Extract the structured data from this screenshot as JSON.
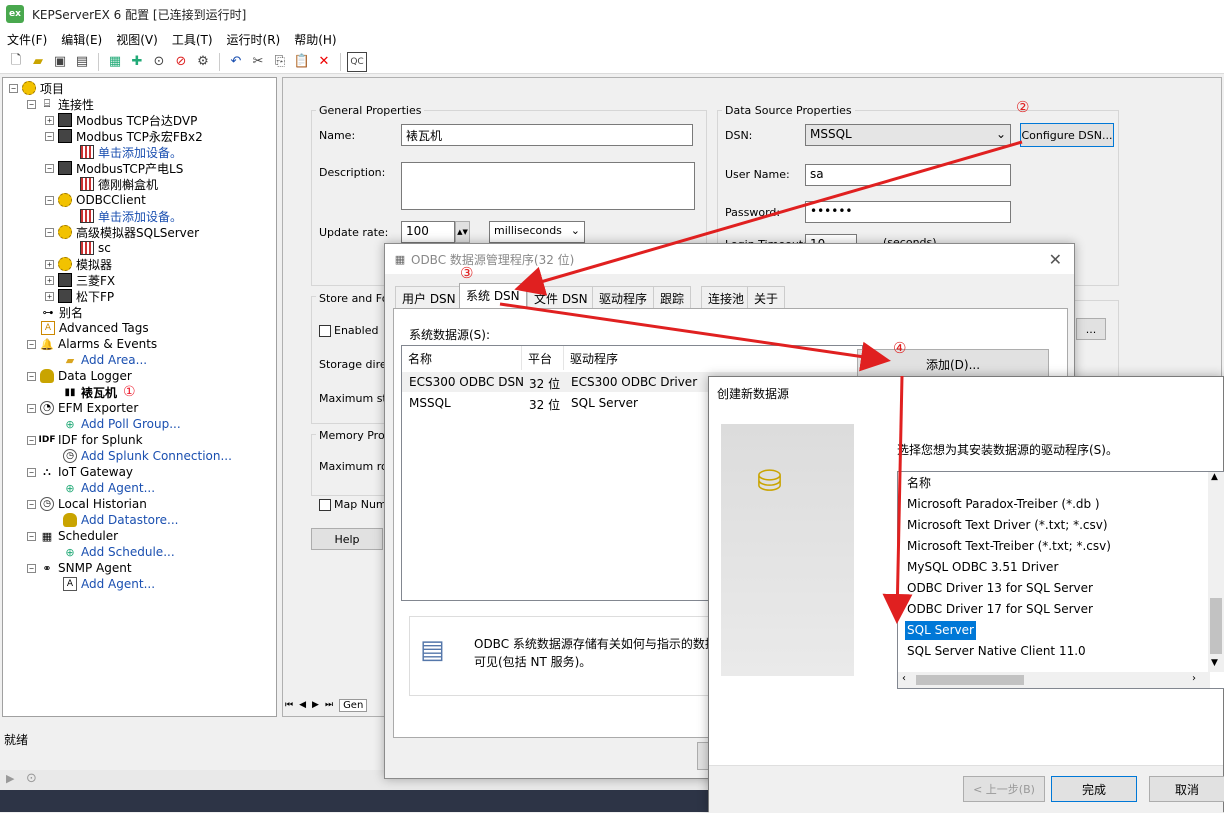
{
  "app": {
    "title": "KEPServerEX 6 配置 [已连接到运行时]",
    "icon_text": "ex"
  },
  "menu": [
    "文件(F)",
    "编辑(E)",
    "视图(V)",
    "工具(T)",
    "运行时(R)",
    "帮助(H)"
  ],
  "toolbar": [
    "new-icon",
    "open-icon",
    "save-icon",
    "save-as-icon",
    "device-icon",
    "add-icon",
    "play-icon",
    "stop-icon",
    "properties-icon",
    "undo-icon",
    "cut-icon",
    "copy-icon",
    "paste-icon",
    "delete-icon",
    "quick-client-icon"
  ],
  "tree": {
    "project": "项目",
    "connectivity": "连接性",
    "items": [
      {
        "label": "Modbus TCP台达DVP",
        "level": 2,
        "icon": "device"
      },
      {
        "label": "Modbus TCP永宏FBx2",
        "level": 2,
        "icon": "device"
      },
      {
        "label": "单击添加设备。",
        "level": 3,
        "icon": "grid",
        "link": true
      },
      {
        "label": "ModbusTCP产电LS",
        "level": 2,
        "icon": "device"
      },
      {
        "label": "德刚槲盒机",
        "level": 3,
        "icon": "grid"
      },
      {
        "label": "ODBCClient",
        "level": 2,
        "icon": "gear"
      },
      {
        "label": "单击添加设备。",
        "level": 3,
        "icon": "grid",
        "link": true
      },
      {
        "label": "高级模拟器SQLServer",
        "level": 2,
        "icon": "gear"
      },
      {
        "label": "sc",
        "level": 3,
        "icon": "grid"
      },
      {
        "label": "模拟器",
        "level": 2,
        "icon": "gear"
      },
      {
        "label": "三菱FX",
        "level": 2,
        "icon": "device"
      },
      {
        "label": "松下FP",
        "level": 2,
        "icon": "device"
      }
    ],
    "alias": "别名",
    "plugins": [
      {
        "label": "Advanced Tags"
      },
      {
        "label": "Alarms & Events",
        "child": "Add Area..."
      },
      {
        "label": "Data Logger",
        "child": "裱瓦机",
        "child_bold": true,
        "annot": "①"
      },
      {
        "label": "EFM Exporter",
        "child": "Add Poll Group..."
      },
      {
        "label": "IDF for Splunk",
        "child": "Add Splunk Connection..."
      },
      {
        "label": "IoT Gateway",
        "child": "Add Agent..."
      },
      {
        "label": "Local Historian",
        "child": "Add Datastore..."
      },
      {
        "label": "Scheduler",
        "child": "Add Schedule..."
      },
      {
        "label": "SNMP Agent",
        "child": "Add Agent..."
      }
    ]
  },
  "props": {
    "general_title": "General Properties",
    "name_label": "Name:",
    "name_value": "裱瓦机",
    "desc_label": "Description:",
    "update_label": "Update rate:",
    "update_value": "100",
    "update_unit": "milliseconds",
    "ds_title": "Data Source Properties",
    "dsn_label": "DSN:",
    "dsn_value": "MSSQL",
    "configure_btn": "Configure DSN...",
    "user_label": "User Name:",
    "user_value": "sa",
    "pwd_label": "Password:",
    "pwd_value": "••••••",
    "login_label": "Login Timeout:",
    "login_value": "10",
    "login_unit": "(seconds)",
    "store_title": "Store and For",
    "enabled_label": "Enabled",
    "storage_label": "Storage direct",
    "max_storage_label": "Maximum stor",
    "memory_title": "Memory Prope",
    "max_rows_label": "Maximum row",
    "map_label": "Map Nume",
    "help_btn": "Help",
    "browse_btn": "...",
    "gen_tab": "Gen"
  },
  "status": {
    "text": "就绪"
  },
  "odbc": {
    "title": "ODBC 数据源管理程序(32 位)",
    "tabs": [
      "用户 DSN",
      "系统 DSN",
      "文件 DSN",
      "驱动程序",
      "跟踪",
      "连接池",
      "关于"
    ],
    "active_tab": 1,
    "list_label": "系统数据源(S):",
    "columns": [
      "名称",
      "平台",
      "驱动程序"
    ],
    "rows": [
      [
        "ECS300 ODBC DSN",
        "32 位",
        "ECS300 ODBC Driver"
      ],
      [
        "MSSQL",
        "32 位",
        "SQL Server"
      ]
    ],
    "add_btn": "添加(D)...",
    "info_line1": "ODBC 系统数据源存储有关如何与指示的数据",
    "info_line2": "可见(包括 NT 服务)。"
  },
  "newds": {
    "title": "创建新数据源",
    "prompt": "选择您想为其安装数据源的驱动程序(S)。",
    "col_header": "名称",
    "drivers": [
      "Microsoft Paradox-Treiber (*.db )",
      "Microsoft Text Driver (*.txt; *.csv)",
      "Microsoft Text-Treiber (*.txt; *.csv)",
      "MySQL ODBC 3.51 Driver",
      "ODBC Driver 13 for SQL Server",
      "ODBC Driver 17 for SQL Server",
      "SQL Server",
      "SQL Server Native Client 11.0"
    ],
    "selected": 6,
    "back_btn": "< 上一步(B)",
    "finish_btn": "完成",
    "cancel_btn": "取消"
  },
  "annotations": {
    "a1": "①",
    "a2": "②",
    "a3": "③",
    "a4": "④"
  },
  "colors": {
    "accent": "#0078d7",
    "annotation": "#e02020",
    "link": "#1a4fb0"
  }
}
